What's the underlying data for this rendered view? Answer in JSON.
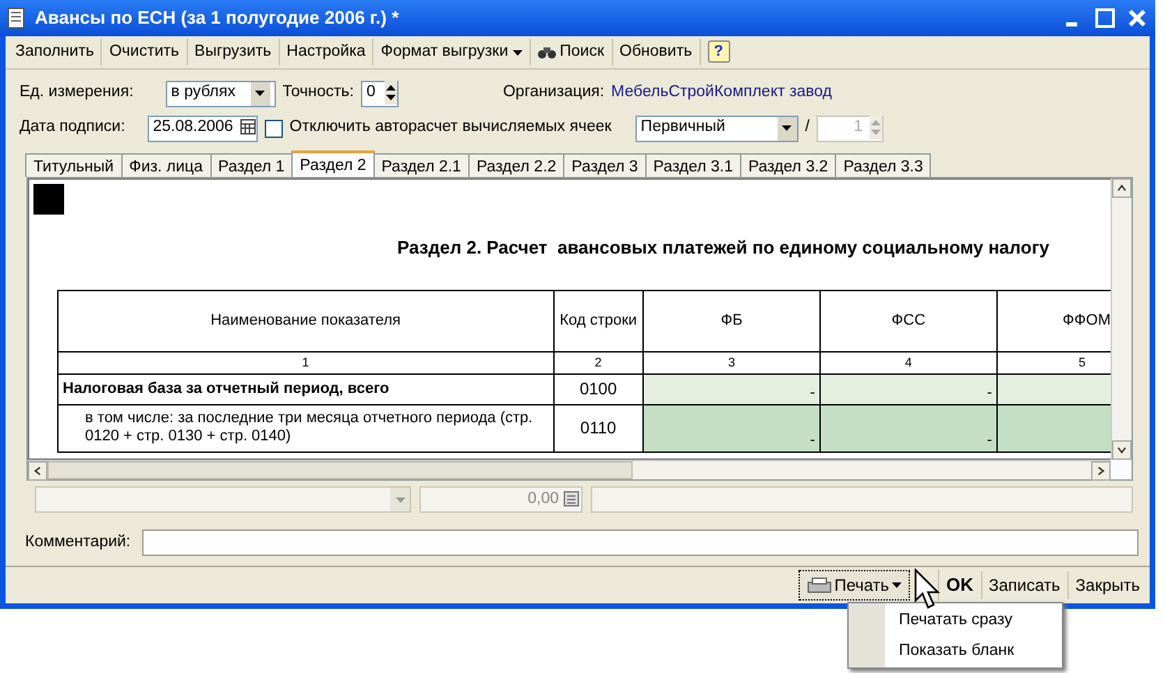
{
  "window": {
    "title": "Авансы по ЕСН (за 1 полугодие 2006 г.) *"
  },
  "toolbar": [
    {
      "label": "Заполнить",
      "kind": "text"
    },
    {
      "label": "Очистить",
      "kind": "text"
    },
    {
      "label": "Выгрузить",
      "kind": "text"
    },
    {
      "label": "Настройка",
      "kind": "text"
    },
    {
      "label": "Формат выгрузки",
      "kind": "dropdown"
    },
    {
      "label": "Поиск",
      "kind": "search"
    },
    {
      "label": "Обновить",
      "kind": "text"
    },
    {
      "label": "?",
      "kind": "help"
    }
  ],
  "form": {
    "units": {
      "label": "Ед. измерения:",
      "value": "в рублях"
    },
    "precision": {
      "label": "Точность:",
      "value": "0"
    },
    "organization": {
      "label": "Организация:",
      "value": "МебельСтройКомплект завод"
    },
    "sign_date": {
      "label": "Дата подписи:",
      "value": "25.08.2006"
    },
    "disable_autocalc": {
      "label": "Отключить авторасчет вычисляемых ячеек",
      "checked": false
    },
    "report_kind": {
      "value": "Первичный"
    },
    "separator": "/",
    "correction": {
      "value": "1",
      "disabled": true
    }
  },
  "tabs": [
    {
      "label": "Титульный",
      "selected": false
    },
    {
      "label": "Физ. лица",
      "selected": false
    },
    {
      "label": "Раздел 1",
      "selected": false
    },
    {
      "label": "Раздел 2",
      "selected": true
    },
    {
      "label": "Раздел 2.1",
      "selected": false
    },
    {
      "label": "Раздел 2.2",
      "selected": false
    },
    {
      "label": "Раздел 3",
      "selected": false
    },
    {
      "label": "Раздел 3.1",
      "selected": false
    },
    {
      "label": "Раздел 3.2",
      "selected": false
    },
    {
      "label": "Раздел 3.3",
      "selected": false
    }
  ],
  "sheet": {
    "title": "Раздел 2. Расчет  авансовых платежей по единому социальному налогу",
    "columns": [
      "Наименование показателя",
      "Код строки",
      "ФБ",
      "ФСС",
      "ФФОМ"
    ],
    "column_numbers": [
      "1",
      "2",
      "3",
      "4",
      "5"
    ],
    "rows": [
      {
        "kind": "total",
        "name": "Налоговая база за отчетный период, всего",
        "code": "0100",
        "values": [
          "-",
          "-"
        ]
      },
      {
        "kind": "detail",
        "name": "в том числе: за последние три месяца отчетного периода (стр. 0120 + стр. 0130 + стр. 0140)",
        "code": "0110",
        "values": [
          "-",
          "-"
        ]
      }
    ]
  },
  "cell_editor": {
    "amount": "0,00",
    "disabled": true
  },
  "comment": {
    "label": "Комментарий:"
  },
  "footer_buttons": [
    {
      "label": "Печать",
      "kind": "print"
    },
    {
      "label": "OK",
      "kind": "default"
    },
    {
      "label": "Записать",
      "kind": "text"
    },
    {
      "label": "Закрыть",
      "kind": "text"
    }
  ],
  "print_menu": [
    {
      "label": "Печатать сразу"
    },
    {
      "label": "Показать бланк"
    }
  ]
}
